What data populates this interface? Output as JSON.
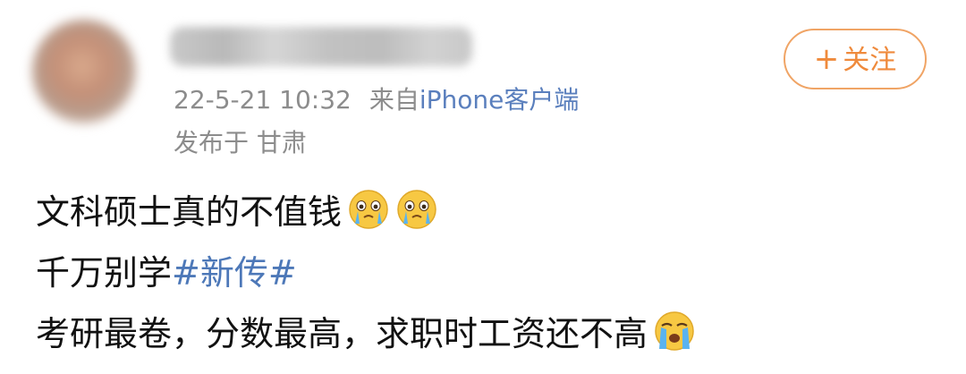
{
  "header": {
    "username": "████████",
    "follow_label": "关注",
    "timestamp": "22-5-21 10:32",
    "source_prefix": "来自",
    "source_client": "iPhone客户端",
    "location": "发布于 甘肃"
  },
  "post": {
    "line1": "文科硕士真的不值钱",
    "line2_text": "千万别学",
    "line2_hashtag": "#新传#",
    "line3": "考研最卷，分数最高，求职时工资还不高"
  },
  "icons": {
    "avatar": "user-avatar-blurred",
    "emoji_1": "crying-face-icon",
    "emoji_2": "crying-face-icon",
    "emoji_3": "loudly-crying-face-icon"
  },
  "colors": {
    "follow_accent": "#ef8a3c",
    "hashtag": "#4d78b8",
    "client_link": "#5a7fbd",
    "meta_gray": "#8c8c8c"
  }
}
